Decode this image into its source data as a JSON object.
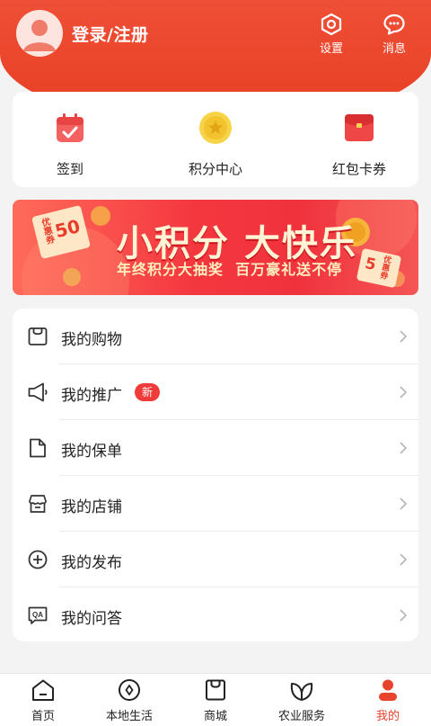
{
  "header": {
    "login_label": "登录/注册",
    "settings_label": "设置",
    "messages_label": "消息"
  },
  "quick_actions": [
    {
      "label": "签到",
      "icon": "calendar-check-icon"
    },
    {
      "label": "积分中心",
      "icon": "gold-coin-star-icon"
    },
    {
      "label": "红包卡券",
      "icon": "red-envelope-icon"
    }
  ],
  "banner": {
    "title": "小积分 大快乐",
    "subtitle": "年终积分大抽奖  百万豪礼送不停",
    "coupon_left_label": "优惠券",
    "coupon_left_value": "50",
    "coupon_right_label": "优惠券",
    "coupon_right_value": "5"
  },
  "menu": [
    {
      "label": "我的购物",
      "icon": "shopping-bag-icon"
    },
    {
      "label": "我的推广",
      "icon": "megaphone-icon",
      "badge": "新"
    },
    {
      "label": "我的保单",
      "icon": "document-icon"
    },
    {
      "label": "我的店铺",
      "icon": "store-icon"
    },
    {
      "label": "我的发布",
      "icon": "plus-circle-icon"
    },
    {
      "label": "我的问答",
      "icon": "qa-chat-icon"
    }
  ],
  "tabbar": [
    {
      "label": "首页",
      "icon": "home-icon"
    },
    {
      "label": "本地生活",
      "icon": "location-icon"
    },
    {
      "label": "商城",
      "icon": "bag-icon"
    },
    {
      "label": "农业服务",
      "icon": "leaf-icon"
    },
    {
      "label": "我的",
      "icon": "user-icon",
      "active": true
    }
  ],
  "colors": {
    "brand": "#e8432c",
    "badge": "#f03b3b",
    "banner_text": "#fff5d6"
  }
}
